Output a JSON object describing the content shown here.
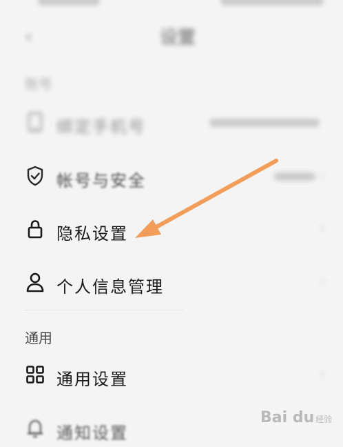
{
  "status_bar": {},
  "header": {
    "back_glyph": "‹",
    "title": "设置"
  },
  "sections": {
    "account_label": "账号",
    "general_label": "通用"
  },
  "rows": {
    "phone": {
      "label": "绑定手机号",
      "value": "",
      "icon": "phone-icon"
    },
    "account_security": {
      "label": "帐号与安全",
      "value": "",
      "icon": "shield-check-icon"
    },
    "privacy": {
      "label": "隐私设置",
      "icon": "lock-icon"
    },
    "personal_info": {
      "label": "个人信息管理",
      "icon": "person-icon"
    },
    "general_settings": {
      "label": "通用设置",
      "icon": "grid-icon"
    },
    "notifications": {
      "label": "通知设置",
      "icon": "bell-icon"
    }
  },
  "annotation": {
    "arrow_color": "#f29d5a"
  },
  "watermark": {
    "text": "Bai du",
    "sub": "经验"
  },
  "colors": {
    "background": "#f4f4f4",
    "text": "#1a1a1a",
    "arrow": "#f29d5a"
  }
}
